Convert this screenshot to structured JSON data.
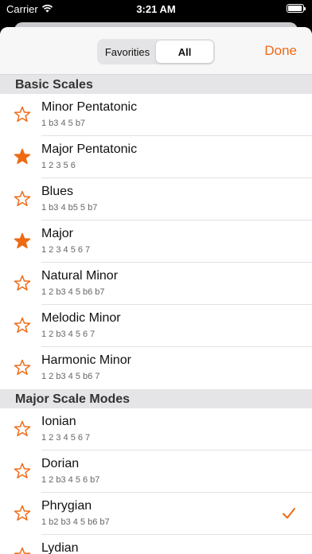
{
  "status_bar": {
    "carrier": "Carrier",
    "time": "3:21 AM"
  },
  "nav": {
    "segments": [
      "Favorities",
      "All"
    ],
    "selected_segment": "All",
    "done_label": "Done"
  },
  "accent_color": "#ee6a14",
  "sections": [
    {
      "title": "Basic Scales",
      "rows": [
        {
          "name": "Minor Pentatonic",
          "formula": "1 b3 4 5 b7",
          "favorite": false,
          "checked": false
        },
        {
          "name": "Major Pentatonic",
          "formula": "1 2 3 5 6",
          "favorite": true,
          "checked": false
        },
        {
          "name": "Blues",
          "formula": "1 b3 4 b5 5 b7",
          "favorite": false,
          "checked": false
        },
        {
          "name": "Major",
          "formula": "1 2 3 4 5 6 7",
          "favorite": true,
          "checked": false
        },
        {
          "name": "Natural Minor",
          "formula": "1 2 b3 4 5 b6 b7",
          "favorite": false,
          "checked": false
        },
        {
          "name": "Melodic Minor",
          "formula": "1 2 b3 4 5 6 7",
          "favorite": false,
          "checked": false
        },
        {
          "name": "Harmonic Minor",
          "formula": "1 2 b3 4 5 b6 7",
          "favorite": false,
          "checked": false
        }
      ]
    },
    {
      "title": "Major Scale Modes",
      "rows": [
        {
          "name": "Ionian",
          "formula": "1 2 3 4 5 6 7",
          "favorite": false,
          "checked": false
        },
        {
          "name": "Dorian",
          "formula": "1 2 b3 4 5 6 b7",
          "favorite": false,
          "checked": false
        },
        {
          "name": "Phrygian",
          "formula": "1 b2 b3 4 5 b6 b7",
          "favorite": false,
          "checked": true
        },
        {
          "name": "Lydian",
          "formula": "",
          "favorite": false,
          "checked": false
        }
      ]
    }
  ]
}
